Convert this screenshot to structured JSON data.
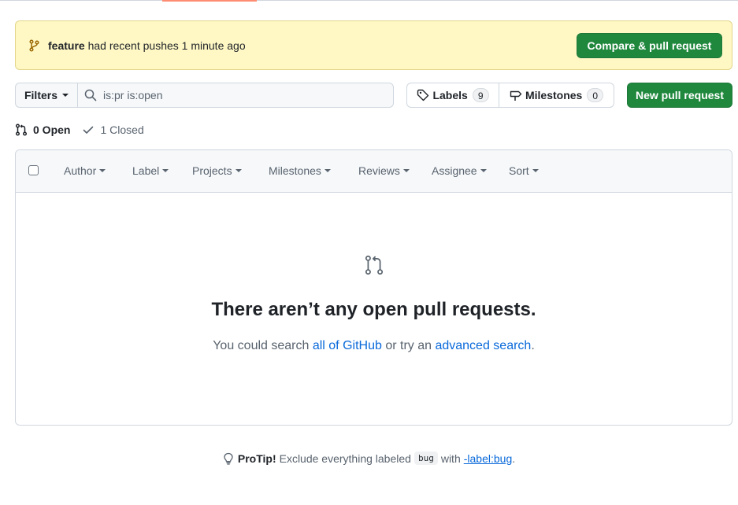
{
  "banner": {
    "branch": "feature",
    "message": "had recent pushes 1 minute ago",
    "compare_button": "Compare & pull request",
    "icon": "git-branch-icon"
  },
  "toolbar": {
    "filters_label": "Filters",
    "search_value": "is:pr is:open",
    "labels_label": "Labels",
    "labels_count": "9",
    "milestones_label": "Milestones",
    "milestones_count": "0",
    "new_pr_label": "New pull request"
  },
  "states": {
    "open": "0 Open",
    "closed": "1 Closed"
  },
  "list_header": {
    "filters": [
      "Author",
      "Label",
      "Projects",
      "Milestones",
      "Reviews",
      "Assignee",
      "Sort"
    ]
  },
  "blankslate": {
    "title": "There aren’t any open pull requests.",
    "text_prefix": "You could search ",
    "link1": "all of GitHub",
    "text_middle": " or try an ",
    "link2": "advanced search",
    "text_suffix": "."
  },
  "protip": {
    "label": "ProTip!",
    "text": "Exclude everything labeled",
    "code": "bug",
    "with": "with",
    "link": "-label:bug",
    "suffix": "."
  },
  "colors": {
    "accent_green": "#1f883d",
    "link_blue": "#0969da",
    "banner_bg": "#fff8c5"
  }
}
